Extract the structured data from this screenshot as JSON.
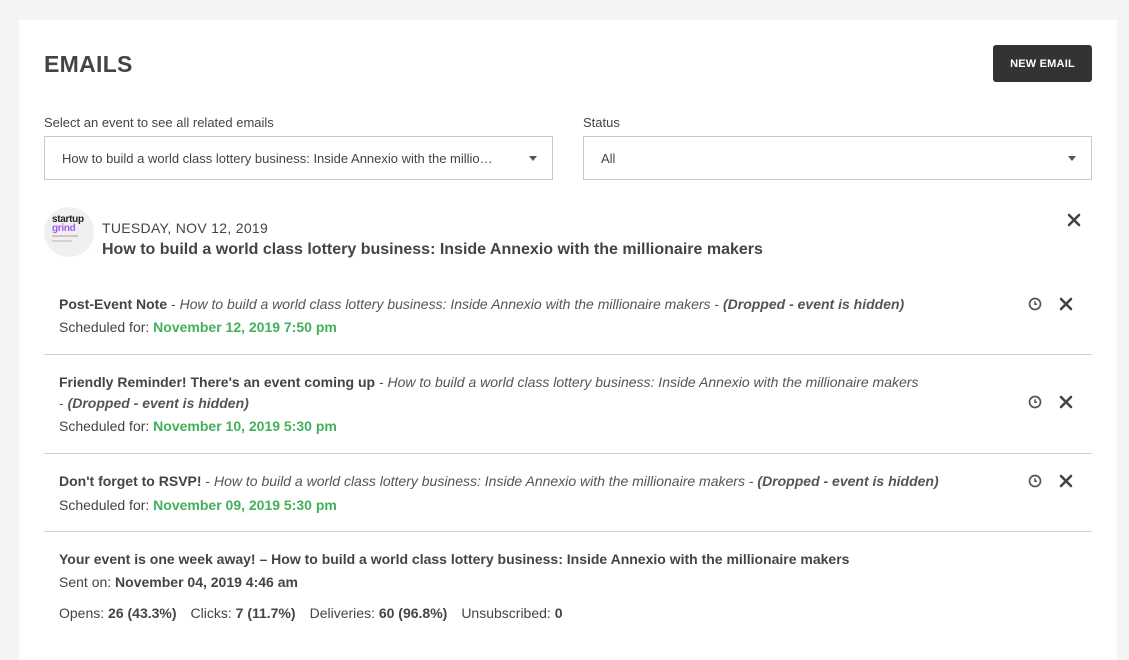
{
  "page": {
    "title": "EMAILS",
    "new_email_label": "NEW EMAIL"
  },
  "filters": {
    "event_label": "Select an event to see all related emails",
    "event_value": "How to build a world class lottery business: Inside Annexio with the millio…",
    "status_label": "Status",
    "status_value": "All"
  },
  "event": {
    "logo_text_1": "startup",
    "logo_text_2": "grind",
    "date": "TUESDAY, NOV 12, 2019",
    "name": "How to build a world class lottery business: Inside Annexio with the millionaire makers"
  },
  "emails": [
    {
      "title": "Post-Event Note",
      "sep": " - ",
      "event": "How to build a world class lottery business: Inside Annexio with the millionaire makers",
      "sep2": " - ",
      "status": "(Dropped - event is hidden)",
      "time_label": "Scheduled for: ",
      "time_value": "November 12, 2019 7:50 pm"
    },
    {
      "title": "Friendly Reminder! There's an event coming up",
      "sep": " - ",
      "event": "How to build a world class lottery business: Inside Annexio with the millionaire makers",
      "sep2": " - ",
      "status": "(Dropped - event is hidden)",
      "time_label": "Scheduled for: ",
      "time_value": "November 10, 2019 5:30 pm"
    },
    {
      "title": "Don't forget to RSVP!",
      "sep": " - ",
      "event": "How to build a world class lottery business: Inside Annexio with the millionaire makers",
      "sep2": " - ",
      "status": "(Dropped - event is hidden)",
      "time_label": "Scheduled for: ",
      "time_value": "November 09, 2019 5:30 pm"
    },
    {
      "title": "Your event is one week away! – How to build a world class lottery business: Inside Annexio with the millionaire makers",
      "time_label": "Sent on: ",
      "time_value": "November 04, 2019 4:46 am",
      "stats": {
        "opens_label": "Opens: ",
        "opens_value": "26 (43.3%)",
        "clicks_label": "Clicks: ",
        "clicks_value": "7 (11.7%)",
        "deliveries_label": "Deliveries: ",
        "deliveries_value": "60 (96.8%)",
        "unsub_label": "Unsubscribed: ",
        "unsub_value": "0"
      }
    }
  ],
  "colors": {
    "accent_green": "#43b05c",
    "button_dark": "#333333",
    "brand_purple": "#a25cf0"
  },
  "icons": [
    "close-icon",
    "clock-icon",
    "chevron-down-icon"
  ]
}
